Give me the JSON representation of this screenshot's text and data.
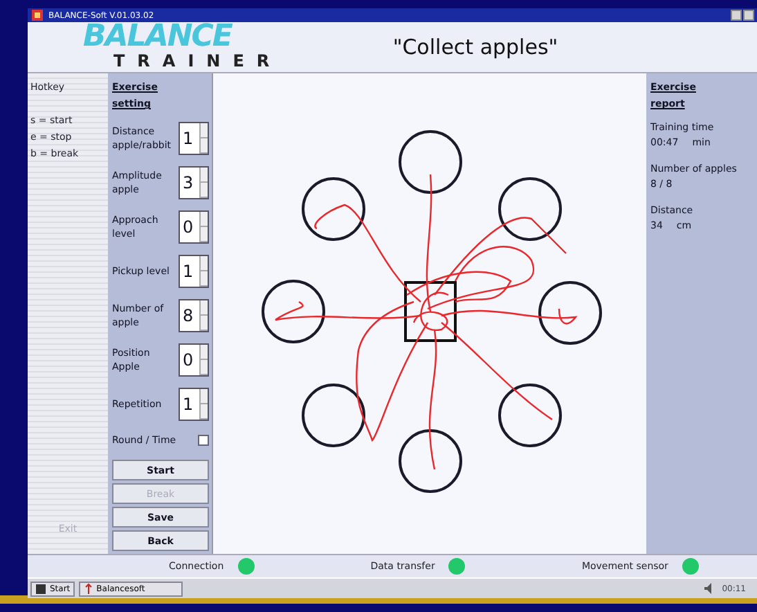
{
  "window": {
    "title": "BALANCE-Soft  V.01.03.02"
  },
  "logo": {
    "top": "BALANCE",
    "bottom": "TRAINER"
  },
  "exercise_title": "\"Collect apples\"",
  "hotkeys": {
    "heading": "Hotkey",
    "items": [
      "s = start",
      "e = stop",
      "b = break"
    ],
    "exit": "Exit"
  },
  "settings": {
    "heading": "Exercise setting",
    "items": [
      {
        "kind": "spinner",
        "label": "Distance apple/rabbit",
        "value": "1"
      },
      {
        "kind": "spinner",
        "label": "Amplitude apple",
        "value": "3"
      },
      {
        "kind": "spinner",
        "label": "Approach level",
        "value": "0"
      },
      {
        "kind": "spinner",
        "label": "Pickup level",
        "value": "1"
      },
      {
        "kind": "spinner",
        "label": "Number of apple",
        "value": "8"
      },
      {
        "kind": "spinner",
        "label": "Position Apple",
        "value": "0"
      },
      {
        "kind": "spinner",
        "label": "Repetition",
        "value": "1"
      },
      {
        "kind": "checkbox",
        "label": "Round / Time",
        "checked": false
      }
    ],
    "buttons": [
      {
        "label": "Start",
        "disabled": false
      },
      {
        "label": "Break",
        "disabled": true
      },
      {
        "label": "Save",
        "disabled": false
      },
      {
        "label": "Back",
        "disabled": false
      }
    ]
  },
  "report": {
    "heading": "Exercise report",
    "items": [
      {
        "label": "Training time",
        "value": "00:47",
        "unit": "min"
      },
      {
        "label": "Number of apples",
        "value": "8 / 8"
      },
      {
        "label": "Distance",
        "value": "34",
        "unit": "cm"
      }
    ]
  },
  "status_bar": [
    {
      "label": "Connection",
      "on": true
    },
    {
      "label": "Data transfer",
      "on": true
    },
    {
      "label": "Movement sensor",
      "on": true
    }
  ],
  "taskbar": {
    "start": "Start",
    "task": "Balancesoft",
    "clock": "00:11"
  }
}
